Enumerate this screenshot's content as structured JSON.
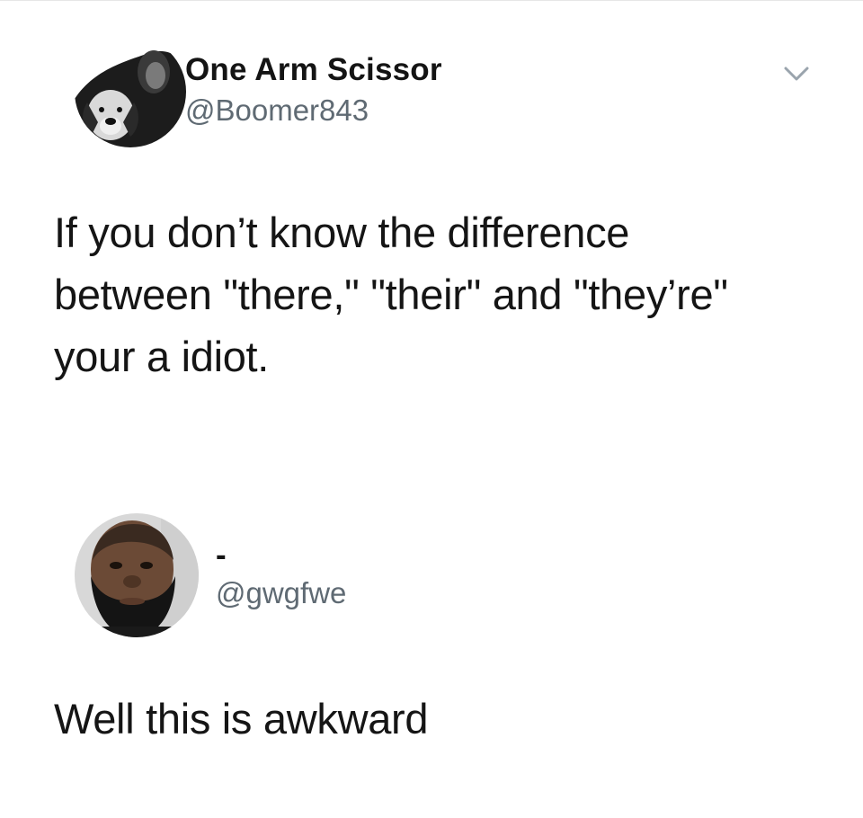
{
  "tweet": {
    "author": {
      "display_name": "One Arm Scissor",
      "handle": "@Boomer843",
      "avatar_icon": "profile-photo-dog"
    },
    "menu_icon": "chevron-down-icon",
    "text_lines": [
      "If you don’t know the difference",
      "between \"there,\" \"their\" and \"they’re\"",
      "your a idiot."
    ]
  },
  "reply": {
    "author": {
      "display_name": "-",
      "handle": "@gwgfwe",
      "avatar_icon": "profile-photo-man"
    },
    "text": "Well this is awkward"
  },
  "colors": {
    "background": "#ffffff",
    "text": "#151515",
    "handle": "#5f6a73",
    "chevron": "#9aa4ad"
  }
}
